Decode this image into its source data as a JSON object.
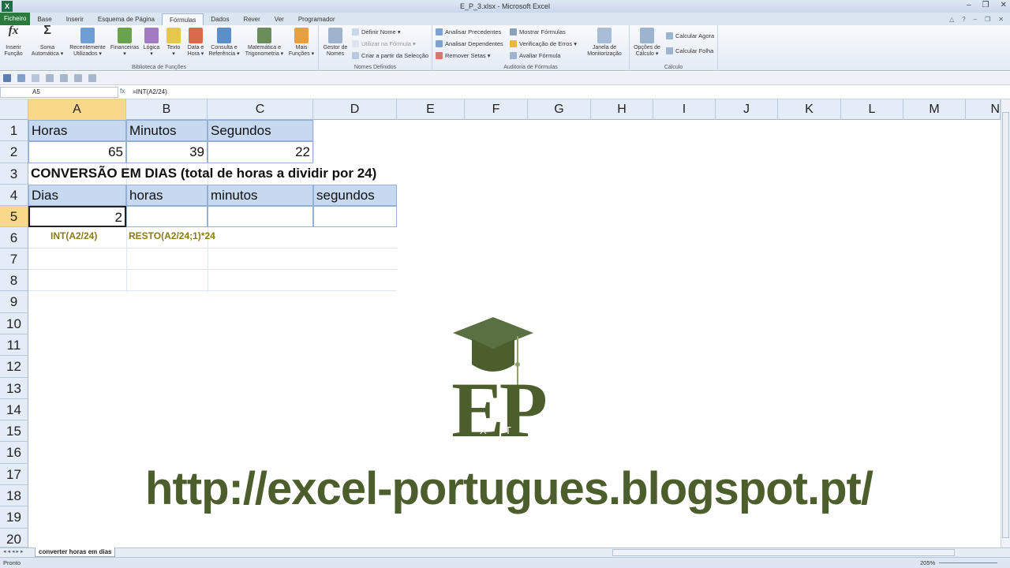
{
  "window": {
    "title": "E_P_3.xlsx - Microsoft Excel",
    "app_icon": "X"
  },
  "tabs": [
    "Ficheiro",
    "Base",
    "Inserir",
    "Esquema de Página",
    "Fórmulas",
    "Dados",
    "Rever",
    "Ver",
    "Programador"
  ],
  "active_tab": "Fórmulas",
  "ribbon": {
    "library": {
      "label": "Biblioteca de Funções",
      "buttons": [
        {
          "l1": "Inserir",
          "l2": "Função"
        },
        {
          "l1": "Soma",
          "l2": "Automática ▾"
        },
        {
          "l1": "Recentemente",
          "l2": "Utilizados ▾"
        },
        {
          "l1": "Financeiras",
          "l2": "▾"
        },
        {
          "l1": "Lógica",
          "l2": "▾"
        },
        {
          "l1": "Texto",
          "l2": "▾"
        },
        {
          "l1": "Data e",
          "l2": "Hora ▾"
        },
        {
          "l1": "Consulta e",
          "l2": "Referência ▾"
        },
        {
          "l1": "Matemática e",
          "l2": "Trigonometria ▾"
        },
        {
          "l1": "Mais",
          "l2": "Funções ▾"
        }
      ]
    },
    "names": {
      "label": "Nomes Definidos",
      "manager": {
        "l1": "Gestor de",
        "l2": "Nomes"
      },
      "define": "Definir Nome ▾",
      "use": "Utilizar na Fórmula ▾",
      "create": "Criar a partir da Selecção"
    },
    "audit": {
      "label": "Auditoria de Fórmulas",
      "precedents": "Analisar Precedentes",
      "dependents": "Analisar Dependentes",
      "remove": "Remover Setas ▾",
      "show": "Mostrar Fórmulas",
      "errors": "Verificação de Erros ▾",
      "evaluate": "Avaliar Fórmula",
      "watch": {
        "l1": "Janela de",
        "l2": "Monitorização"
      }
    },
    "calc": {
      "label": "Cálculo",
      "options": {
        "l1": "Opções de",
        "l2": "Cálculo ▾"
      },
      "now": "Calcular Agora",
      "sheet": "Calcular Folha"
    }
  },
  "formula_bar": {
    "name_box": "A5",
    "fx": "fx",
    "formula": "=INT(A2/24)"
  },
  "columns": [
    "A",
    "B",
    "C",
    "D",
    "E",
    "F",
    "G",
    "H",
    "I",
    "J",
    "K",
    "L",
    "M",
    "N"
  ],
  "rows": [
    "1",
    "2",
    "3",
    "4",
    "5",
    "6",
    "7",
    "8",
    "9",
    "10",
    "11",
    "12",
    "13",
    "14",
    "15",
    "16",
    "17",
    "18",
    "19",
    "20"
  ],
  "cells": {
    "A1": "Horas",
    "B1": "Minutos",
    "C1": "Segundos",
    "A2": "65",
    "B2": "39",
    "C2": "22",
    "A3": "CONVERSÃO EM DIAS (total de horas a dividir por 24)",
    "A4": "Dias",
    "B4": "horas",
    "C4": "minutos",
    "D4": "segundos",
    "A5": "2"
  },
  "notes": {
    "A6": "INT(A2/24)",
    "B6": "RESTO(A2/24;1)*24"
  },
  "watermark": {
    "letters": "EP",
    "small": "X T",
    "url": "http://excel-portugues.blogspot.pt/"
  },
  "sheet_tab": "converter horas em dias",
  "status": {
    "ready": "Pronto",
    "zoom": "205%"
  },
  "colors": {
    "header_fill": "#c6d9f1",
    "selected_header": "#f8d889",
    "watermark": "#4c5e2c",
    "note": "#8a7a16"
  }
}
